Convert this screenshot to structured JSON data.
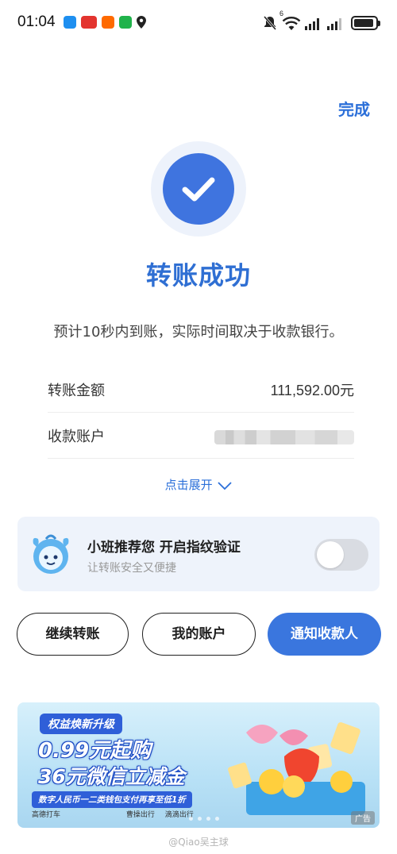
{
  "status_bar": {
    "time": "01:04",
    "network_label": "6"
  },
  "header": {
    "done_label": "完成"
  },
  "result": {
    "title": "转账成功",
    "subtitle": "预计10秒内到账，实际时间取决于收款银行。"
  },
  "details": {
    "amount_label": "转账金额",
    "amount_value": "111,592.00元",
    "account_label": "收款账户",
    "account_value_blurred": true,
    "expand_label": "点击展开"
  },
  "promo": {
    "title": "小班推荐您 开启指纹验证",
    "subtitle": "让转账安全又便捷",
    "toggle_on": false
  },
  "actions": {
    "continue_label": "继续转账",
    "my_account_label": "我的账户",
    "notify_label": "通知收款人"
  },
  "banner": {
    "tag": "权益焕新升级",
    "line1": "0.99元起购",
    "line2": "36元微信立减金",
    "strip": "数字人民币一二类钱包支付再享至低1折",
    "logos": [
      "高德打车",
      "曹操出行",
      "滴滴出行"
    ],
    "ad_label": "广告"
  },
  "watermark": "@Qiao吴主球",
  "colors": {
    "primary_blue": "#3a76de",
    "title_blue": "#2f6fd3",
    "promo_bg": "#eef3fb"
  }
}
